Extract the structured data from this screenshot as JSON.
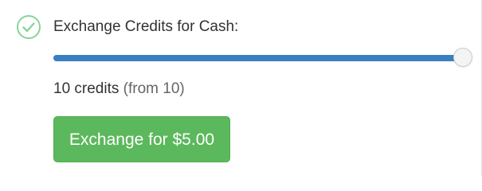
{
  "exchange": {
    "status_icon": "check-circle-icon",
    "title": "Exchange Credits for Cash:",
    "slider": {
      "min": 0,
      "max": 10,
      "value": 10,
      "fill_color": "#3a7fc1"
    },
    "credits_text": "10 credits",
    "from_text": "(from 10)",
    "button_label": "Exchange for $5.00",
    "button_color": "#5cb85c",
    "check_color": "#8cd39a"
  }
}
